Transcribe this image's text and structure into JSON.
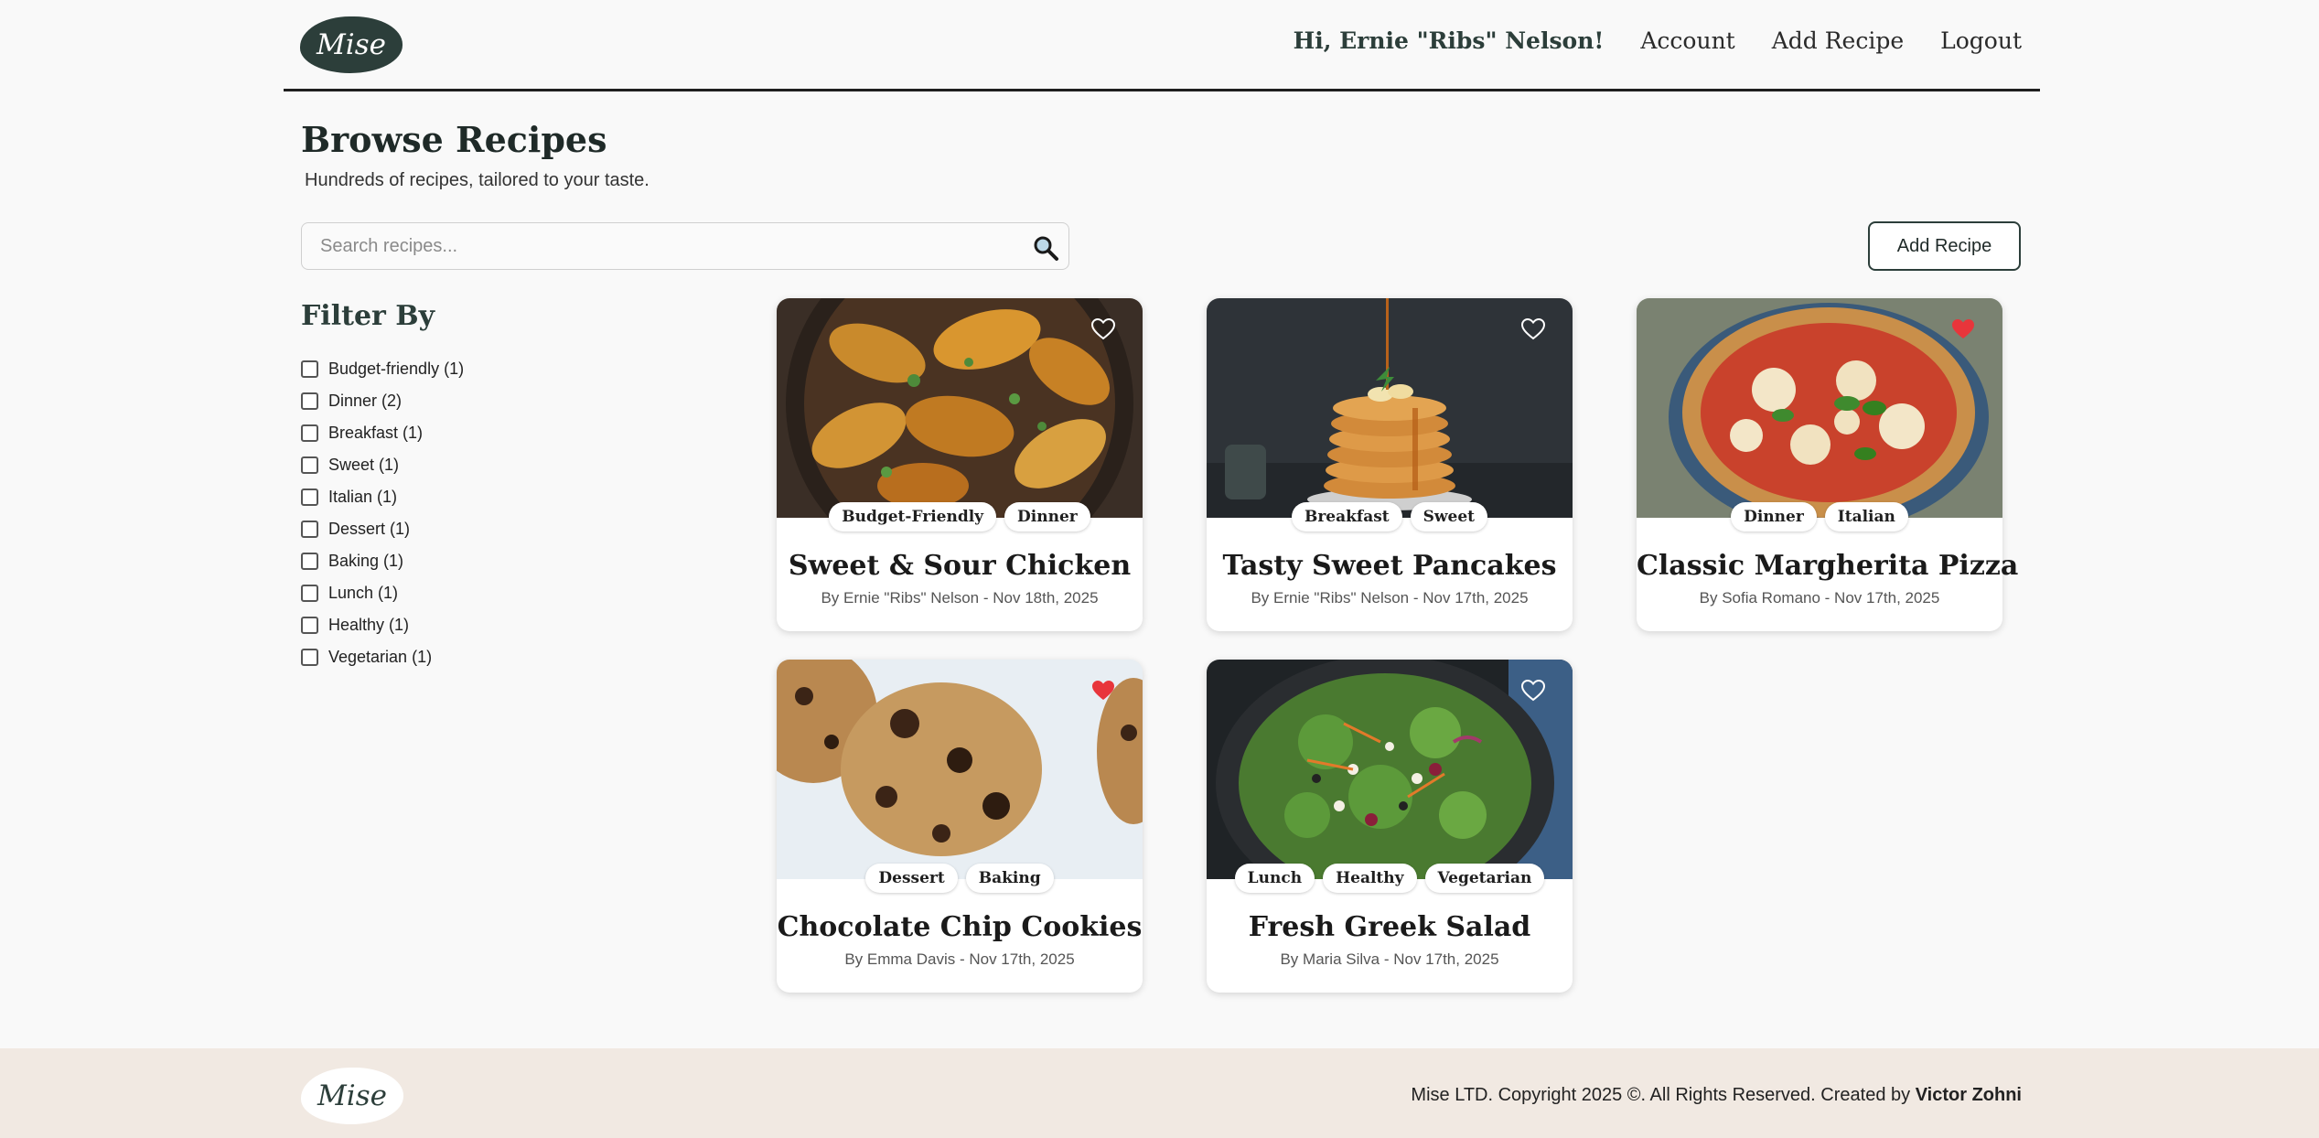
{
  "brand": {
    "logo_text": "Mise"
  },
  "nav": {
    "greeting": "Hi, Ernie \"Ribs\" Nelson!",
    "account": "Account",
    "add_recipe": "Add Recipe",
    "logout": "Logout"
  },
  "page": {
    "title": "Browse Recipes",
    "subtitle": "Hundreds of recipes, tailored to your taste."
  },
  "search": {
    "placeholder": "Search recipes..."
  },
  "add_button": "Add Recipe",
  "filter": {
    "title": "Filter By",
    "items": [
      {
        "label": "Budget-friendly (1)",
        "checked": false
      },
      {
        "label": "Dinner (2)",
        "checked": false
      },
      {
        "label": "Breakfast (1)",
        "checked": false
      },
      {
        "label": "Sweet (1)",
        "checked": false
      },
      {
        "label": "Italian (1)",
        "checked": false
      },
      {
        "label": "Dessert (1)",
        "checked": false
      },
      {
        "label": "Baking (1)",
        "checked": false
      },
      {
        "label": "Lunch (1)",
        "checked": false
      },
      {
        "label": "Healthy (1)",
        "checked": false
      },
      {
        "label": "Vegetarian (1)",
        "checked": false
      }
    ]
  },
  "recipes": [
    {
      "title": "Sweet & Sour Chicken",
      "meta": "By Ernie \"Ribs\" Nelson - Nov 18th, 2025",
      "tags": [
        "Budget-Friendly",
        "Dinner"
      ],
      "favorited": false
    },
    {
      "title": "Tasty Sweet Pancakes",
      "meta": "By Ernie \"Ribs\" Nelson - Nov 17th, 2025",
      "tags": [
        "Breakfast",
        "Sweet"
      ],
      "favorited": false
    },
    {
      "title": "Classic Margherita Pizza",
      "meta": "By Sofia Romano - Nov 17th, 2025",
      "tags": [
        "Dinner",
        "Italian"
      ],
      "favorited": true
    },
    {
      "title": "Chocolate Chip Cookies",
      "meta": "By Emma Davis - Nov 17th, 2025",
      "tags": [
        "Dessert",
        "Baking"
      ],
      "favorited": true
    },
    {
      "title": "Fresh Greek Salad",
      "meta": "By Maria Silva - Nov 17th, 2025",
      "tags": [
        "Lunch",
        "Healthy",
        "Vegetarian"
      ],
      "favorited": false
    }
  ],
  "footer": {
    "copyright": "Mise LTD. Copyright 2025 ©. All Rights Reserved. Created by ",
    "creator": "Victor Zohni"
  },
  "colors": {
    "accent": "#2c3e3a",
    "heart_active": "#e8353b",
    "footer_bg": "#f1e9e2"
  }
}
